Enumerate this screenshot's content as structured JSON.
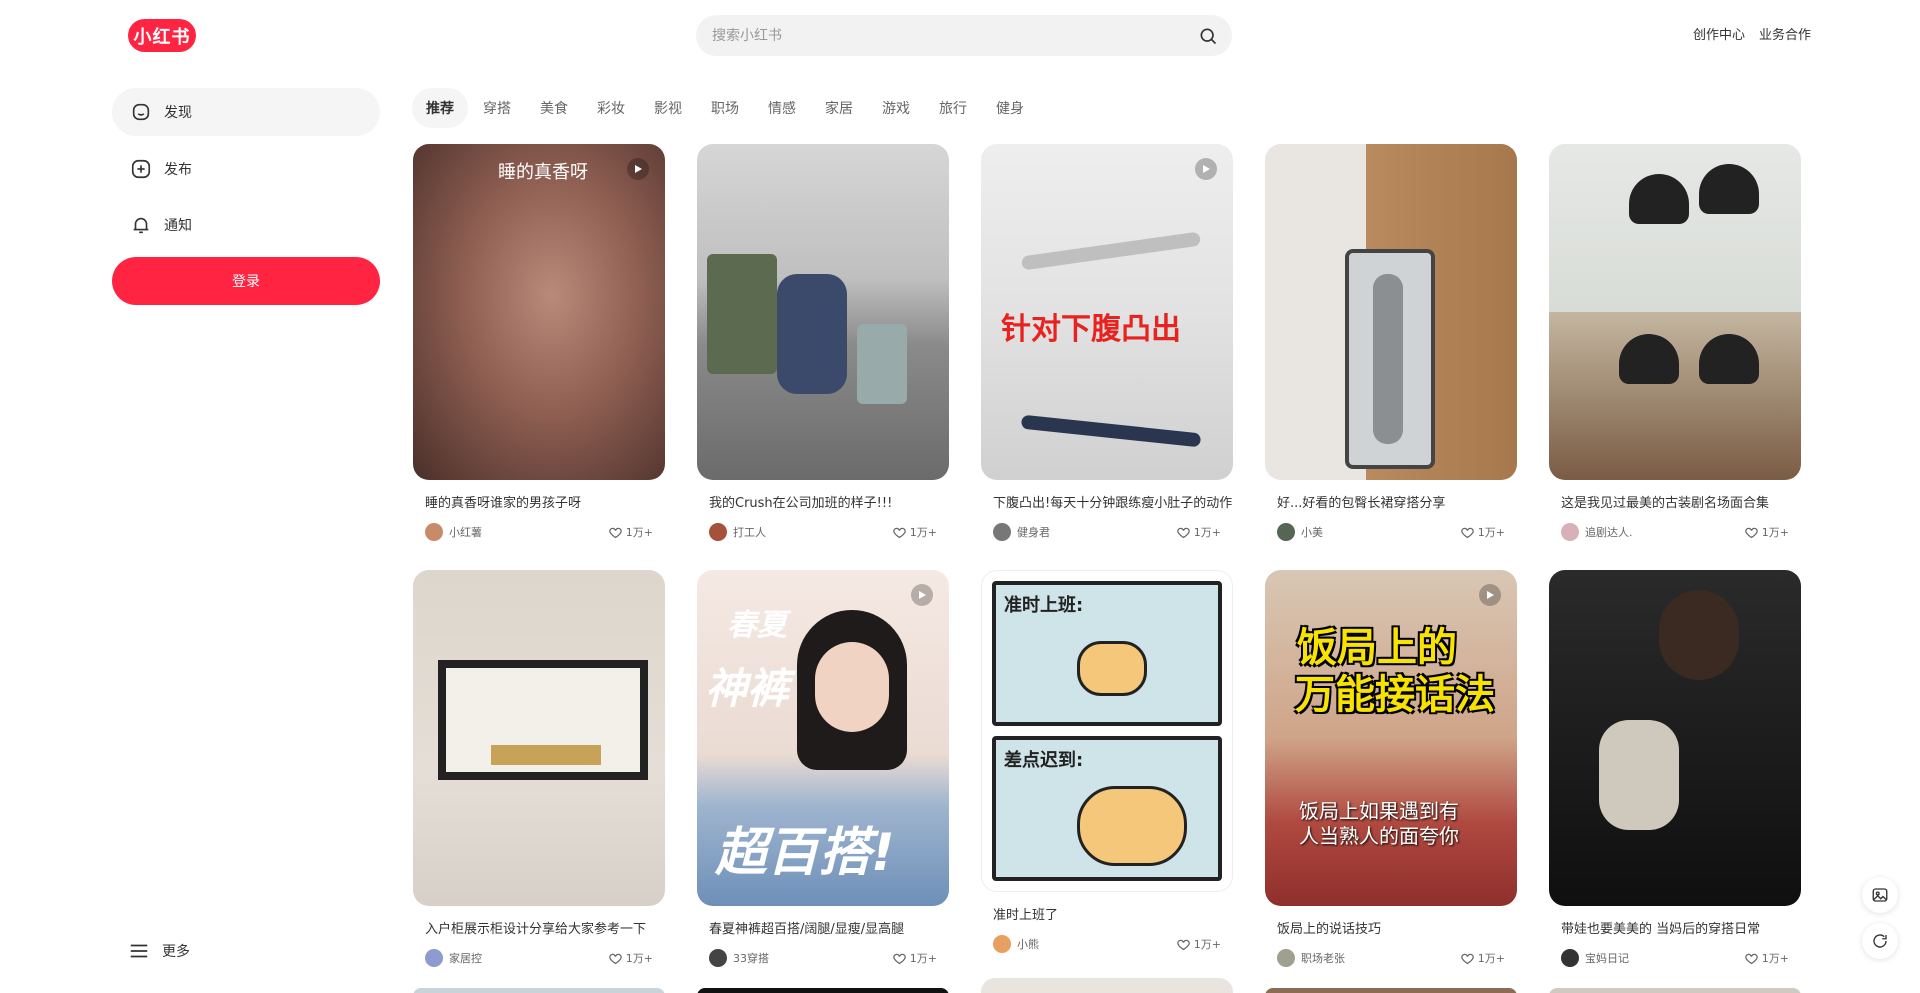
{
  "header": {
    "logo": "小红书",
    "search_placeholder": "搜索小红书",
    "nav": [
      "创作中心",
      "业务合作"
    ]
  },
  "sidebar": {
    "items": [
      {
        "label": "发现",
        "icon": "home-icon"
      },
      {
        "label": "发布",
        "icon": "plus-icon"
      },
      {
        "label": "通知",
        "icon": "bell-icon"
      }
    ],
    "login_label": "登录",
    "more_label": "更多"
  },
  "channels": [
    "推荐",
    "穿搭",
    "美食",
    "彩妆",
    "影视",
    "职场",
    "情感",
    "家居",
    "游戏",
    "旅行",
    "健身"
  ],
  "cards": [
    {
      "title": "睡的真香呀谁家的男孩子呀",
      "author": "小红薯",
      "likes": "1万+",
      "cover_text": "睡的真香呀",
      "video": true,
      "avatar": "#c98a6a"
    },
    {
      "title": "我的Crush在公司加班的样子!!!",
      "author": "打工人",
      "likes": "1万+",
      "cover_text": "",
      "video": false,
      "avatar": "#a4523a"
    },
    {
      "title": "下腹凸出!每天十分钟跟练瘦小肚子的动作",
      "author": "健身君",
      "likes": "1万+",
      "cover_text": "针对下腹凸出",
      "video": true,
      "avatar": "#777777"
    },
    {
      "title": "好...好看的包臀长裙穿搭分享",
      "author": "小美",
      "likes": "1万+",
      "cover_text": "",
      "video": false,
      "avatar": "#556655"
    },
    {
      "title": "这是我见过最美的古装剧名场面合集",
      "author": "追剧达人.",
      "likes": "1万+",
      "cover_text": "",
      "video": false,
      "avatar": "#d8b0b8"
    },
    {
      "title": "入户柜展示柜设计分享给大家参考一下",
      "author": "家居控",
      "likes": "1万+",
      "cover_text": "",
      "video": false,
      "avatar": "#8e9ad0"
    },
    {
      "title": "春夏神裤超百搭/阔腿/显瘦/显高腿",
      "author": "33穿搭",
      "likes": "1万+",
      "cover_text": "春夏|神裤|超百搭!",
      "video": true,
      "avatar": "#444444"
    },
    {
      "title": "准时上班了",
      "author": "小熊",
      "likes": "1万+",
      "cover_text": "准时上班:|差点迟到:",
      "video": false,
      "avatar": "#e8a060"
    },
    {
      "title": "饭局上的说话技巧",
      "author": "职场老张",
      "likes": "1万+",
      "cover_text": "饭局上的|万能接话法|饭局上如果遇到有|人当熟人的面夸你",
      "video": true,
      "avatar": "#a0a090"
    },
    {
      "title": "带娃也要美美的 当妈后的穿搭日常",
      "author": "宝妈日记",
      "likes": "1万+",
      "cover_text": "",
      "video": false,
      "avatar": "#333333"
    }
  ],
  "colors": {
    "brand": "#ff2442",
    "active_bg": "#f5f5f5"
  }
}
